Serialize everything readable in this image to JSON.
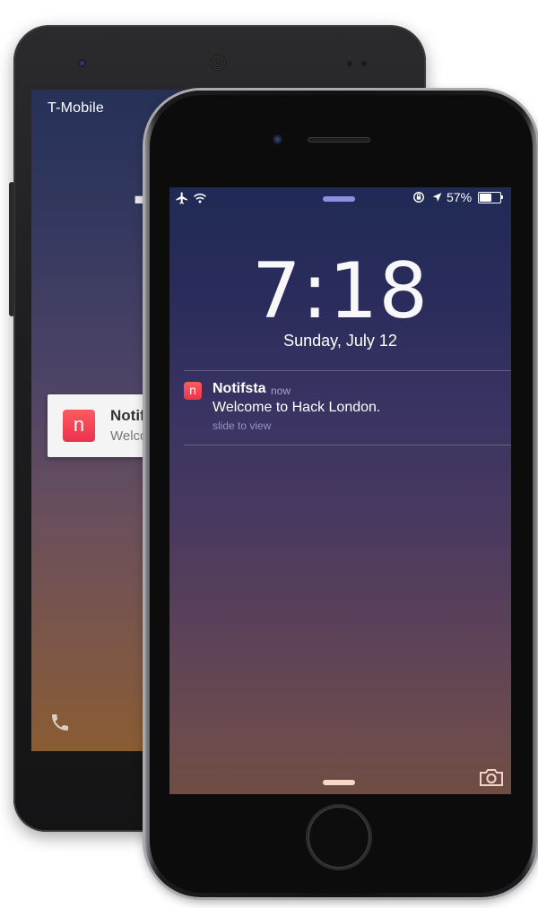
{
  "android": {
    "carrier": "T-Mobile",
    "clock_fragment": "7",
    "notification": {
      "icon_letter": "n",
      "title": "Notif",
      "text": "Welco"
    },
    "phone_icon": "phone-icon"
  },
  "iphone": {
    "status": {
      "battery_percent": "57%",
      "battery_level": 0.57,
      "icons": [
        "airplane-icon",
        "wifi-icon",
        "rotation-lock-icon",
        "location-arrow-icon",
        "battery-icon"
      ]
    },
    "lock": {
      "time": "7:18",
      "date": "Sunday, July 12"
    },
    "notification": {
      "icon_letter": "n",
      "app": "Notifsta",
      "time": "now",
      "message": "Welcome to Hack London.",
      "action": "slide to view"
    },
    "camera_icon": "camera-icon"
  },
  "colors": {
    "brand_red": "#ee3b52",
    "accent_lavender": "#8d8fe0"
  }
}
